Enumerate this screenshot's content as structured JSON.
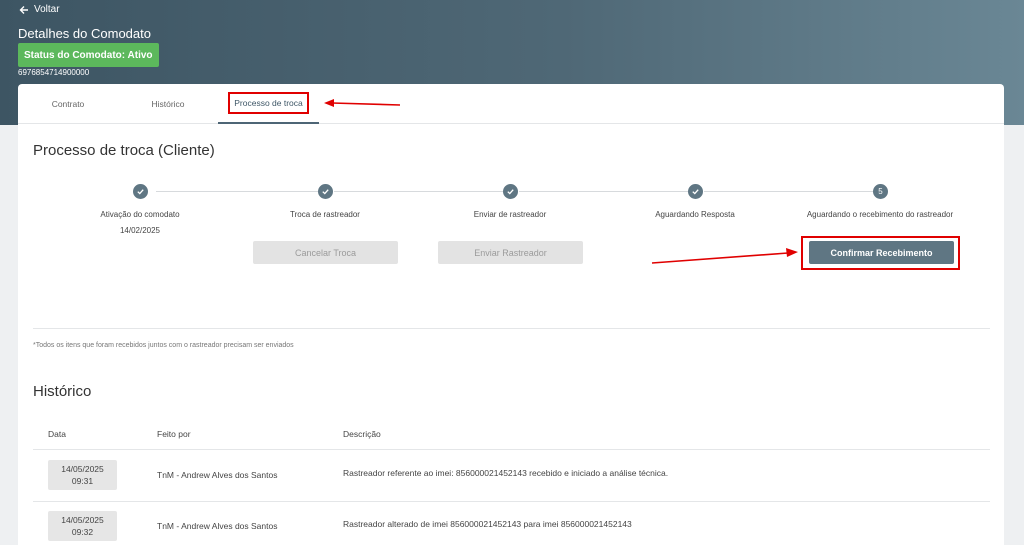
{
  "header": {
    "back_label": "Voltar",
    "title": "Detalhes do Comodato",
    "status_badge": "Status do Comodato: Ativo",
    "serial": "6976854714900000"
  },
  "tabs": [
    {
      "label": "Contrato"
    },
    {
      "label": "Histórico"
    },
    {
      "label": "Processo de troca",
      "active": true
    }
  ],
  "process": {
    "title": "Processo de troca (Cliente)",
    "steps": [
      {
        "label": "Ativação do comodato",
        "date": "14/02/2025",
        "done": true
      },
      {
        "label": "Troca de rastreador",
        "done": true
      },
      {
        "label": "Enviar de rastreador",
        "done": true
      },
      {
        "label": "Aguardando Resposta",
        "done": true
      },
      {
        "label": "Aguardando o recebimento do rastreador",
        "number": "5",
        "done": false
      }
    ],
    "buttons": {
      "cancel": "Cancelar Troca",
      "send": "Enviar Rastreador",
      "confirm": "Confirmar Recebimento"
    },
    "footnote": "*Todos os itens que foram recebidos juntos com o rastreador precisam ser enviados"
  },
  "history": {
    "title": "Histórico",
    "columns": [
      "Data",
      "Feito por",
      "Descrição"
    ],
    "rows": [
      {
        "date": "14/05/2025",
        "time": "09:31",
        "by": "TnM - Andrew Alves dos Santos",
        "description": "Rastreador referente ao imei: 856000021452143 recebido e iniciado a análise técnica."
      },
      {
        "date": "14/05/2025",
        "time": "09:32",
        "by": "TnM - Andrew Alves dos Santos",
        "description": "Rastreador alterado de imei 856000021452143 para imei 856000021452143"
      }
    ]
  },
  "colors": {
    "accent": "#5f7683",
    "status_green": "#5cb85c",
    "annotation_red": "#e00000"
  }
}
